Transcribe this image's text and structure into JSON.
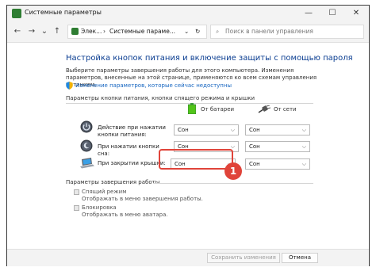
{
  "window": {
    "title": "Системные параметры"
  },
  "address": {
    "path_1": "Элек...",
    "path_2": "Системные параме...",
    "search_placeholder": "Поиск в панели управления"
  },
  "page": {
    "title": "Настройка кнопок питания и включение защиты с помощью пароля",
    "description": "Выберите параметры завершения работы для этого компьютера. Изменения параметров, внесенные на этой странице, применяются ко всем схемам управления питанием.",
    "admin_link": "Изменение параметров, которые сейчас недоступны",
    "section_buttons": "Параметры кнопки питания, кнопки спящего режима и крышки",
    "col_battery": "От батареи",
    "col_ac": "От сети",
    "rows": [
      {
        "label": "Действие при нажатии кнопки питания:",
        "battery": "Сон",
        "ac": "Сон"
      },
      {
        "label": "При нажатии кнопки сна:",
        "battery": "Сон",
        "ac": "Сон"
      },
      {
        "label": "При закрытии крышки:",
        "battery": "Сон",
        "ac": "Сон"
      }
    ],
    "section_shutdown": "Параметры завершения работы",
    "options": [
      {
        "label": "Спящий режим",
        "desc": "Отображать в меню завершения работы."
      },
      {
        "label": "Блокировка",
        "desc": "Отображать в меню аватара."
      }
    ]
  },
  "footer": {
    "save": "Сохранить изменения",
    "cancel": "Отмена"
  },
  "annotation": {
    "number": "1",
    "color": "#e0443a"
  }
}
